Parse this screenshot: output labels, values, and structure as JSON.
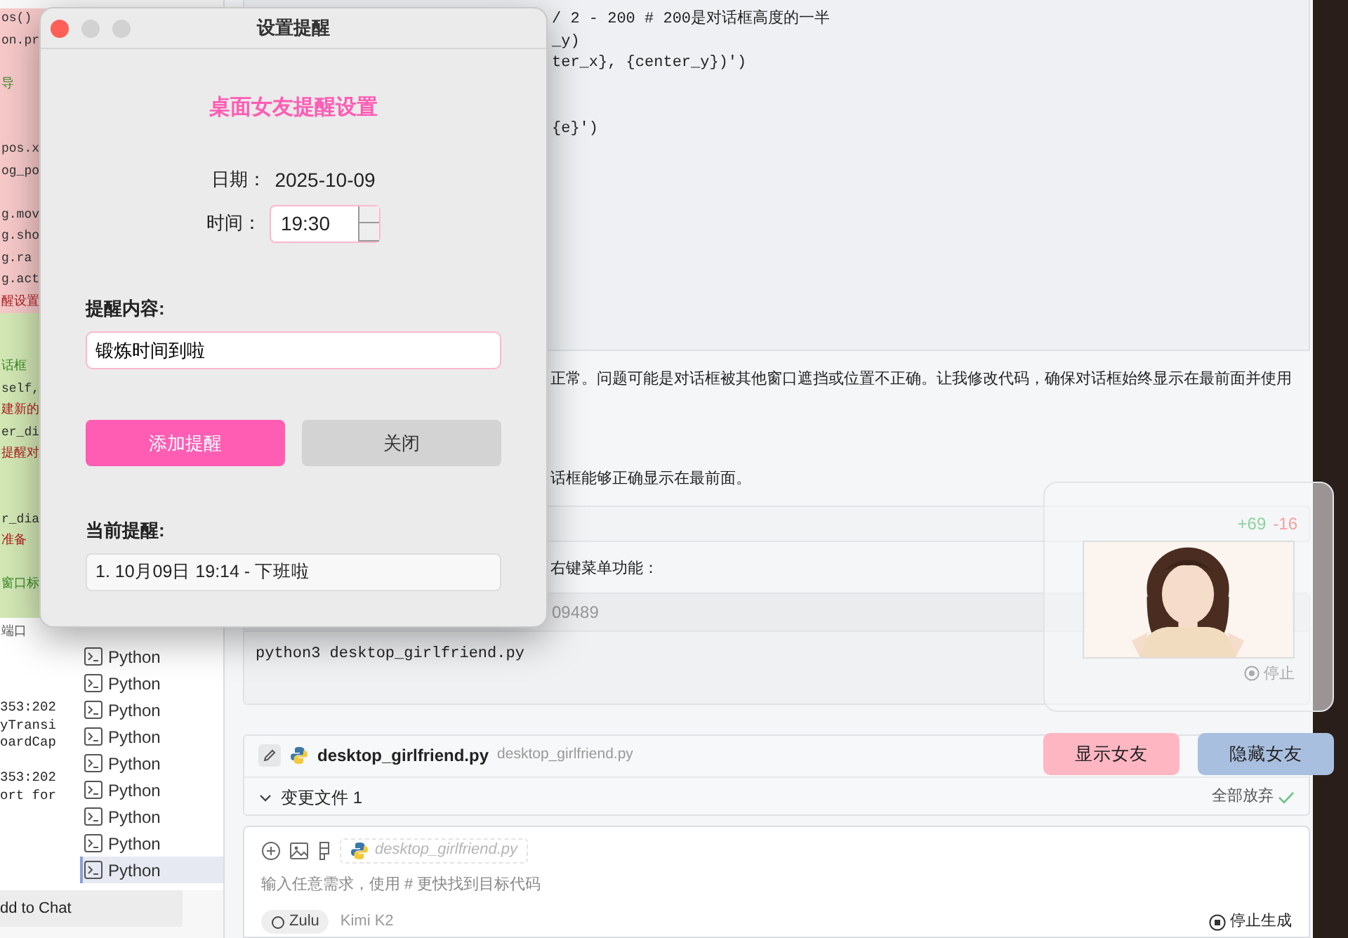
{
  "editor": {
    "lines": [
      {
        "kind": "removed",
        "text": "os()"
      },
      {
        "kind": "removed",
        "text": "on.pr"
      },
      {
        "kind": "removed"
      },
      {
        "kind": "removed",
        "text": "导",
        "comment": true
      },
      {
        "kind": "removed"
      },
      {
        "kind": "removed"
      },
      {
        "kind": "removed",
        "text": "pos.x"
      },
      {
        "kind": "removed",
        "text": "og_po"
      },
      {
        "kind": "removed"
      },
      {
        "kind": "removed",
        "text": "g.mov"
      },
      {
        "kind": "removed",
        "text": "g.sho"
      },
      {
        "kind": "removed",
        "text": "g.ra"
      },
      {
        "kind": "removed",
        "text": "g.act"
      },
      {
        "kind": "removed",
        "text": "醒设置",
        "string": true
      },
      {
        "kind": "added"
      },
      {
        "kind": "added"
      },
      {
        "kind": "added",
        "text": "话框",
        "comment": true
      },
      {
        "kind": "added",
        "text": "self,"
      },
      {
        "kind": "added",
        "text": "建新的",
        "string": true
      },
      {
        "kind": "added",
        "text": "er_di"
      },
      {
        "kind": "added",
        "text": "提醒对",
        "string": true
      },
      {
        "kind": "added"
      },
      {
        "kind": "added"
      },
      {
        "kind": "added",
        "text": "r_dia"
      },
      {
        "kind": "added",
        "text": "准备",
        "string": true
      },
      {
        "kind": "added"
      },
      {
        "kind": "added",
        "text": "窗口标",
        "comment": true
      },
      {
        "kind": "added"
      }
    ]
  },
  "terminal": {
    "title": "端口",
    "output": [
      {
        "text": "353:202"
      },
      {
        "text": "yTransi"
      },
      {
        "text": "oardCap"
      },
      {
        "kind": "blank"
      },
      {
        "text": "353:202"
      },
      {
        "text": "ort for"
      }
    ],
    "sessions": [
      {
        "label": "Python",
        "selected": false
      },
      {
        "label": "Python",
        "selected": false
      },
      {
        "label": "Python",
        "selected": false
      },
      {
        "label": "Python",
        "selected": false
      },
      {
        "label": "Python",
        "selected": false
      },
      {
        "label": "Python",
        "selected": false
      },
      {
        "label": "Python",
        "selected": false
      },
      {
        "label": "Python",
        "selected": false
      },
      {
        "label": "Python",
        "selected": true
      }
    ]
  },
  "add_to_chat": "dd to Chat",
  "chat": {
    "code_lines": [
      {
        "text": "/ 2 - 200  # 200是对话框高度的一半"
      },
      {
        "text": "_y)"
      },
      {
        "text": "ter_x}, {center_y})')"
      },
      {
        "kind": "blank"
      },
      {
        "kind": "blank"
      },
      {
        "text": "{e}')"
      }
    ],
    "messages": [
      "正常。问题可能是对话框被其他窗口遮挡或位置不正确。让我修改代码，确保对话框始终显示在最前面并使用",
      "话框能够正确显示在最前面。"
    ],
    "diff": {
      "added": "+69",
      "removed": "-16"
    },
    "note": "右键菜单功能：",
    "command": {
      "id": "09489",
      "text": "python3 desktop_girlfriend.py",
      "stop": "停止"
    },
    "file_card": {
      "file": "desktop_girlfriend.py",
      "path": "desktop_girlfriend.py",
      "changes": "变更文件 1",
      "discard": "全部放弃"
    },
    "composer": {
      "context_file": "desktop_girlfriend.py",
      "placeholder": "输入任意需求，使用 # 更快找到目标代码",
      "agent": "Zulu",
      "model": "Kimi K2",
      "stop": "停止生成"
    }
  },
  "dialog": {
    "title": "设置提醒",
    "heading": "桌面女友提醒设置",
    "date_label": "日期：",
    "date": "2025-10-09",
    "time_label": "时间：",
    "time": "19:30",
    "content_label": "提醒内容:",
    "content": "锻炼时间到啦",
    "buttons": [
      {
        "label": "添加提醒",
        "kind": "primary"
      },
      {
        "label": "关闭",
        "kind": "secondary"
      }
    ],
    "list_label": "当前提醒:",
    "reminders": [
      "1. 10月09日 19:14 - 下班啦"
    ]
  },
  "widget": {
    "buttons": [
      {
        "label": "显示女友",
        "kind": "show"
      },
      {
        "label": "隐藏女友",
        "kind": "hide"
      }
    ]
  }
}
